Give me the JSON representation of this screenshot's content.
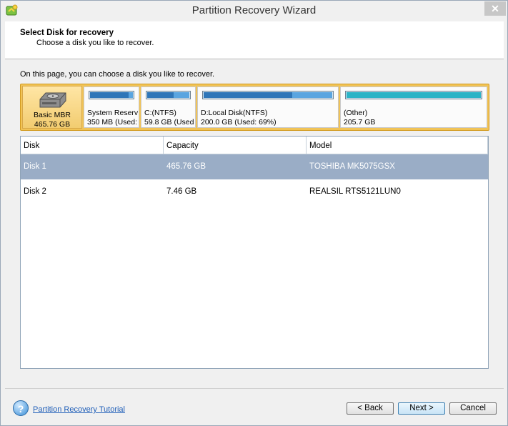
{
  "window": {
    "title": "Partition Recovery Wizard",
    "close_glyph": "✕"
  },
  "header": {
    "title": "Select Disk for recovery",
    "subtitle": "Choose a disk you like to recover."
  },
  "intro": "On this page, you can choose a disk you like to recover.",
  "disk_map": {
    "disk": {
      "label": "Basic MBR",
      "size": "465.76 GB",
      "icon": "hard-drive-icon"
    },
    "partitions": [
      {
        "name": "System Reserv",
        "info": "350 MB (Used:",
        "used_fraction": 0.9
      },
      {
        "name": "C:(NTFS)",
        "info": "59.8 GB (Used",
        "used_fraction": 0.62
      },
      {
        "name": "D:Local Disk(NTFS)",
        "info": "200.0 GB (Used: 69%)",
        "used_fraction": 0.69
      },
      {
        "name": "(Other)",
        "info": "205.7 GB",
        "used_fraction": 1.0
      }
    ]
  },
  "table": {
    "columns": [
      "Disk",
      "Capacity",
      "Model"
    ],
    "rows": [
      {
        "disk": "Disk 1",
        "capacity": "465.76 GB",
        "model": "TOSHIBA MK5075GSX",
        "selected": true
      },
      {
        "disk": "Disk 2",
        "capacity": "7.46 GB",
        "model": "REALSIL RTS5121LUN0",
        "selected": false
      }
    ]
  },
  "footer": {
    "help_icon": "help-icon",
    "tutorial_link": "Partition Recovery Tutorial",
    "back_label": "< Back",
    "next_label": "Next >",
    "cancel_label": "Cancel"
  },
  "colors": {
    "selection": "#9aadc6",
    "disk_highlight": "#f1c356",
    "bar_used": "#2f76b8",
    "other_bar": "#2bb3c6"
  }
}
